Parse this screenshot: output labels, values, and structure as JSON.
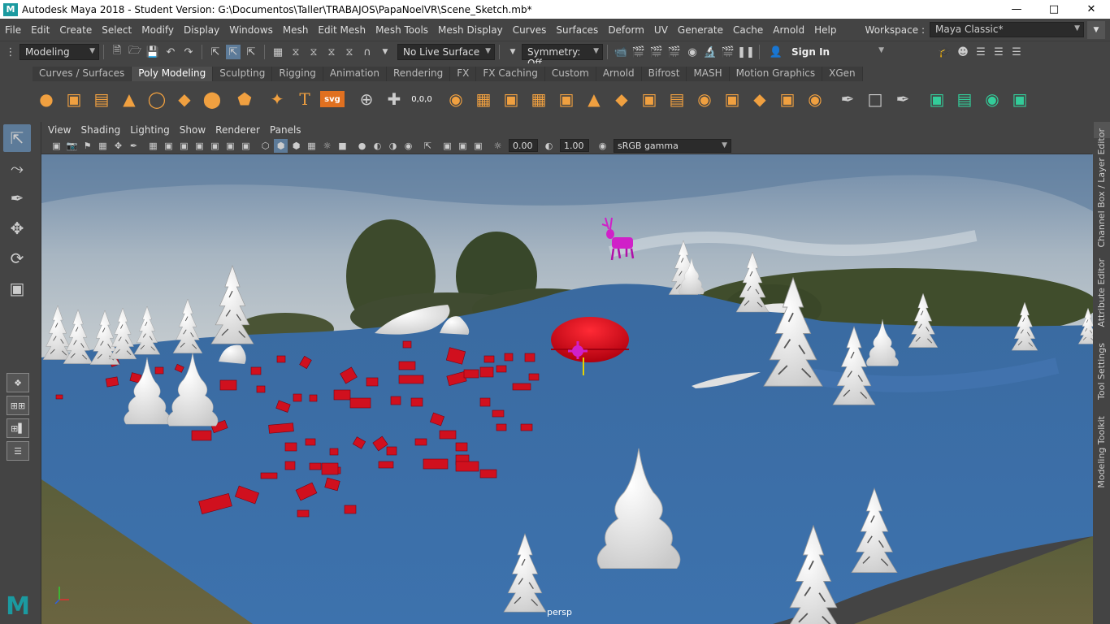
{
  "window": {
    "logo": "M",
    "title": "Autodesk Maya 2018 - Student Version: G:\\Documentos\\Taller\\TRABAJOS\\PapaNoelVR\\Scene_Sketch.mb*",
    "minimize": "—",
    "maximize": "□",
    "close": "✕"
  },
  "menu": {
    "items": [
      "File",
      "Edit",
      "Create",
      "Select",
      "Modify",
      "Display",
      "Windows",
      "Mesh",
      "Edit Mesh",
      "Mesh Tools",
      "Mesh Display",
      "Curves",
      "Surfaces",
      "Deform",
      "UV",
      "Generate",
      "Cache",
      "Arnold",
      "Help"
    ],
    "workspace_label": "Workspace :",
    "workspace_value": "Maya Classic*"
  },
  "status": {
    "menuset": "Modeling",
    "live_surface": "No Live Surface",
    "symmetry": "Symmetry: Off",
    "sign_in": "Sign In"
  },
  "shelf": {
    "tabs": [
      "Curves / Surfaces",
      "Poly Modeling",
      "Sculpting",
      "Rigging",
      "Animation",
      "Rendering",
      "FX",
      "FX Caching",
      "Custom",
      "Arnold",
      "Bifrost",
      "MASH",
      "Motion Graphics",
      "XGen"
    ],
    "active_tab": "Poly Modeling",
    "text_tool": "T",
    "svg_tool": "svg",
    "coords_tool": "0,0,0"
  },
  "panel": {
    "menus": [
      "View",
      "Shading",
      "Lighting",
      "Show",
      "Renderer",
      "Panels"
    ],
    "exposure": "0.00",
    "gamma": "1.00",
    "color_space": "sRGB gamma",
    "camera": "persp"
  },
  "right_tabs": [
    "Channel Box / Layer Editor",
    "Attribute Editor",
    "Tool Settings",
    "Modeling Toolkit"
  ],
  "colors": {
    "ground": "#3b6ea8",
    "accent": "#5d7b99",
    "logo": "#1b9aa0",
    "red_objects": "#d0101e",
    "reindeer": "#d020c8"
  }
}
